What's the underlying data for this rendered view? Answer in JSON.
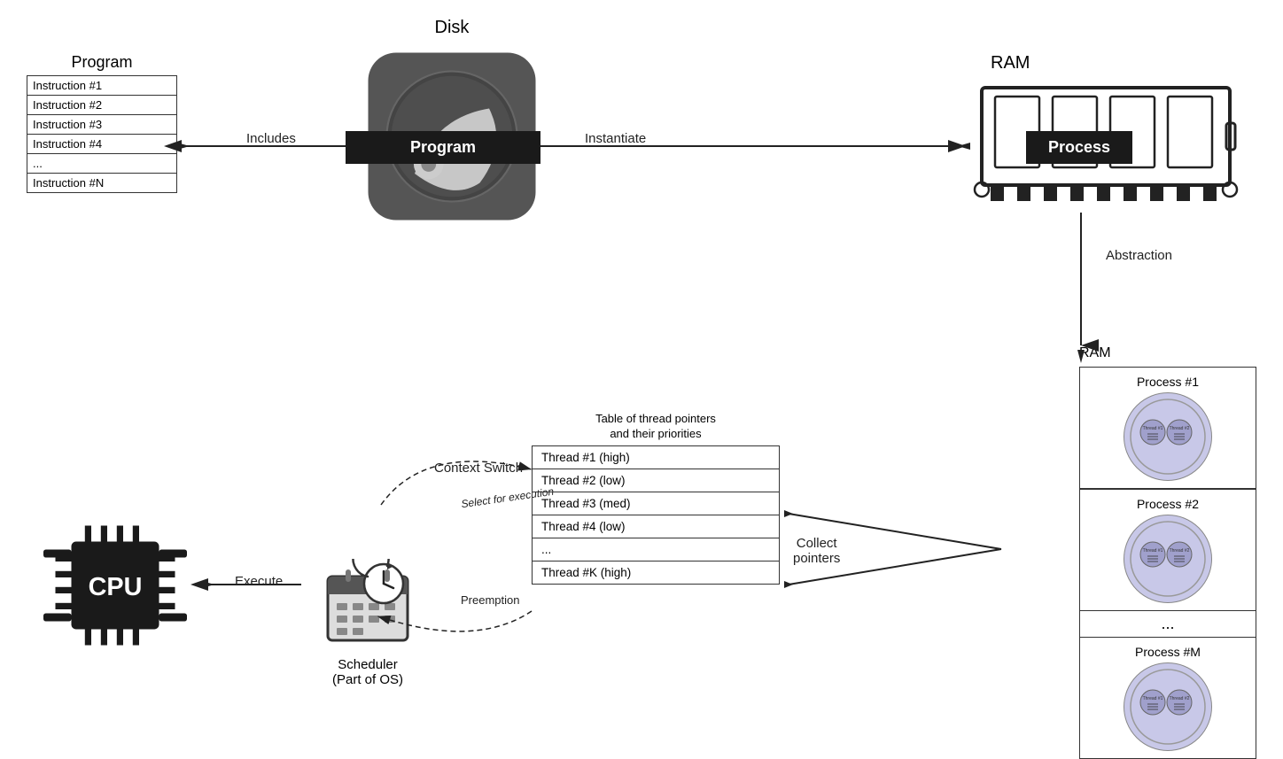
{
  "program": {
    "label": "Program",
    "instructions": [
      "Instruction #1",
      "Instruction #2",
      "Instruction #3",
      "Instruction #4",
      "...",
      "Instruction #N"
    ]
  },
  "disk": {
    "label": "Disk",
    "program_bar": "Program"
  },
  "ram_top": {
    "label": "RAM",
    "process_bar": "Process"
  },
  "arrows": {
    "includes": "Includes",
    "instantiate": "Instantiate",
    "abstraction": "Abstraction",
    "execute": "Execute",
    "context_switch": "Context Switch",
    "select_for_execution": "Select for execution",
    "preemption": "Preemption",
    "collect_pointers": "Collect\npointers"
  },
  "thread_table": {
    "title": "Table of thread pointers\nand their priorities",
    "threads": [
      "Thread #1 (high)",
      "Thread #2 (low)",
      "Thread #3 (med)",
      "Thread #4 (low)",
      "...",
      "Thread #K (high)"
    ]
  },
  "scheduler": {
    "label": "Scheduler\n(Part of OS)"
  },
  "cpu": {
    "label": "CPU"
  },
  "ram_bottom": {
    "label": "RAM"
  },
  "processes": [
    {
      "label": "Process #1",
      "threads": [
        "Thread #1",
        "Thread #2"
      ]
    },
    {
      "label": "Process #2",
      "threads": [
        "Thread #1",
        "Thread #2"
      ]
    },
    {
      "label": "...",
      "threads": []
    },
    {
      "label": "Process #M",
      "threads": [
        "Thread #1",
        "Thread #2"
      ]
    }
  ]
}
